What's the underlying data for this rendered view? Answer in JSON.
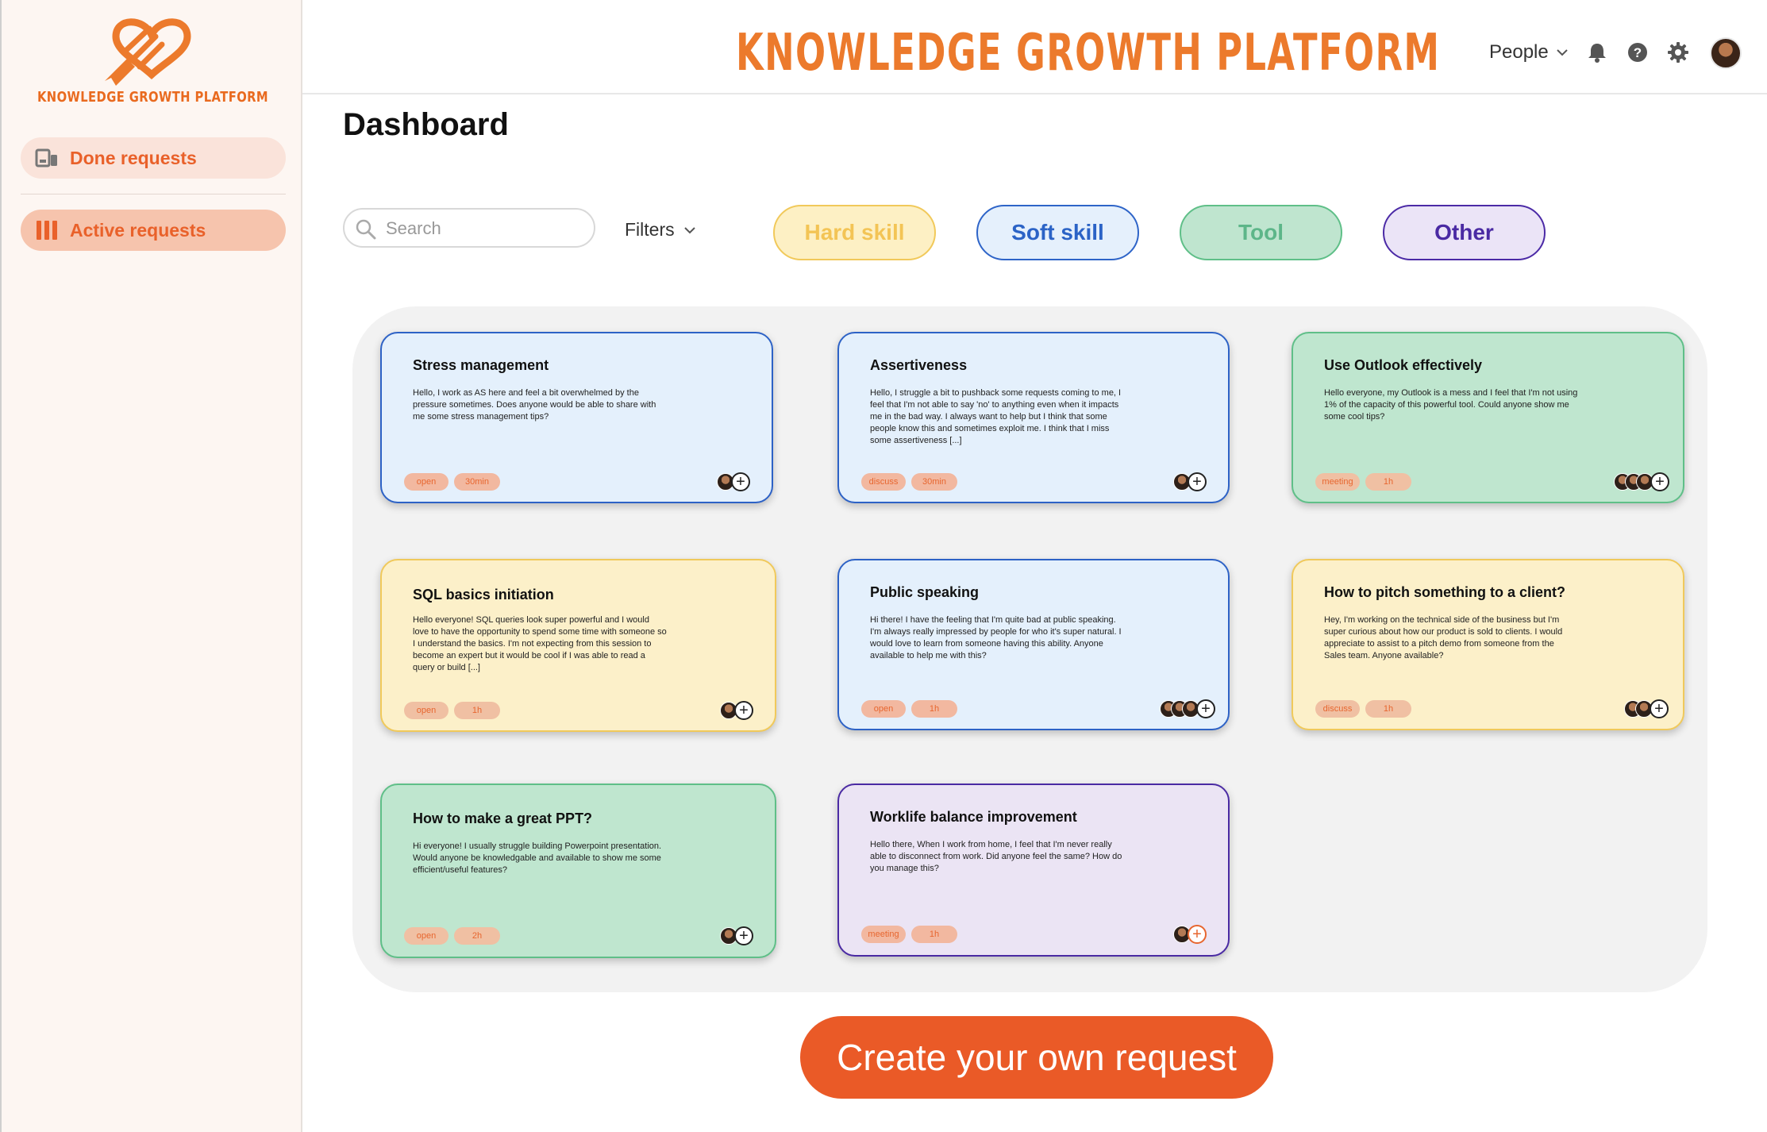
{
  "brand": {
    "logo_text": "KNOWLEDGE GROWTH PLATFORM",
    "title": "KNOWLEDGE GROWTH PLATFORM",
    "accent": "#ec7a2c"
  },
  "sidebar": {
    "items": [
      {
        "label": "Done requests",
        "icon": "archive-icon"
      },
      {
        "label": "Active requests",
        "icon": "columns-icon"
      }
    ]
  },
  "header": {
    "people_label": "People",
    "icons": [
      "bell-icon",
      "help-icon",
      "gear-icon",
      "avatar"
    ]
  },
  "page": {
    "title": "Dashboard"
  },
  "search": {
    "placeholder": "Search"
  },
  "filters": {
    "label": "Filters"
  },
  "categories": [
    {
      "label": "Hard skill",
      "color": "#f1c95a"
    },
    {
      "label": "Soft skill",
      "color": "#2e64c8"
    },
    {
      "label": "Tool",
      "color": "#5fbf88"
    },
    {
      "label": "Other",
      "color": "#4a2aa3"
    }
  ],
  "cards": [
    {
      "title": "Stress management",
      "body": "Hello, I work as AS here and feel a bit overwhelmed by the pressure sometimes. Does anyone would be able to share with me some stress management tips?",
      "tags": [
        "open",
        "30min"
      ],
      "category": "Soft skill",
      "avatars": 1
    },
    {
      "title": "Assertiveness",
      "body": "Hello, I struggle a bit to pushback some requests coming to me, I feel that I'm not able to say 'no' to anything even when it impacts me in the bad way. I always want to help but I think that some people know this and sometimes exploit me. I think that I miss some assertiveness [...]",
      "tags": [
        "discuss",
        "30min"
      ],
      "category": "Soft skill",
      "avatars": 1
    },
    {
      "title": "Use Outlook effectively",
      "body": "Hello everyone, my Outlook is a mess and I feel that I'm not using 1% of the capacity of this powerful tool. Could anyone show me some cool tips?",
      "tags": [
        "meeting",
        "1h"
      ],
      "category": "Tool",
      "avatars": 3
    },
    {
      "title": "SQL basics initiation",
      "body": "Hello everyone! SQL queries look super powerful and I would love to have the opportunity to spend some time with someone so I understand the basics. I'm not expecting from this session to become an expert but it would be cool if I was able to read a query or build [...]",
      "tags": [
        "open",
        "1h"
      ],
      "category": "Hard skill",
      "avatars": 1
    },
    {
      "title": "Public speaking",
      "body": "Hi there! I have the feeling that I'm quite bad at public speaking. I'm always really impressed by people for who it's super natural. I would love to learn from someone having this ability. Anyone available to help me with this?",
      "tags": [
        "open",
        "1h"
      ],
      "category": "Soft skill",
      "avatars": 3
    },
    {
      "title": "How to pitch something to a client?",
      "body": "Hey, I'm working on the technical side of the business but I'm super curious about how our product is sold to clients. I would appreciate to assist to a pitch demo from someone from the Sales team. Anyone available?",
      "tags": [
        "discuss",
        "1h"
      ],
      "category": "Hard skill",
      "avatars": 2
    },
    {
      "title": "How to make a great PPT?",
      "body": "Hi everyone! I usually struggle building Powerpoint presentation. Would anyone be knowledgable and available to show me some efficient/useful features?",
      "tags": [
        "open",
        "2h"
      ],
      "category": "Tool",
      "avatars": 1
    },
    {
      "title": "Worklife balance improvement",
      "body": "Hello there, When I work from home, I feel that I'm never really able to disconnect from work. Did anyone feel the same? How do you manage this?",
      "tags": [
        "meeting",
        "1h"
      ],
      "category": "Other",
      "avatars": 1
    }
  ],
  "cta": {
    "label": "Create your own request",
    "color": "#ea5a27"
  }
}
